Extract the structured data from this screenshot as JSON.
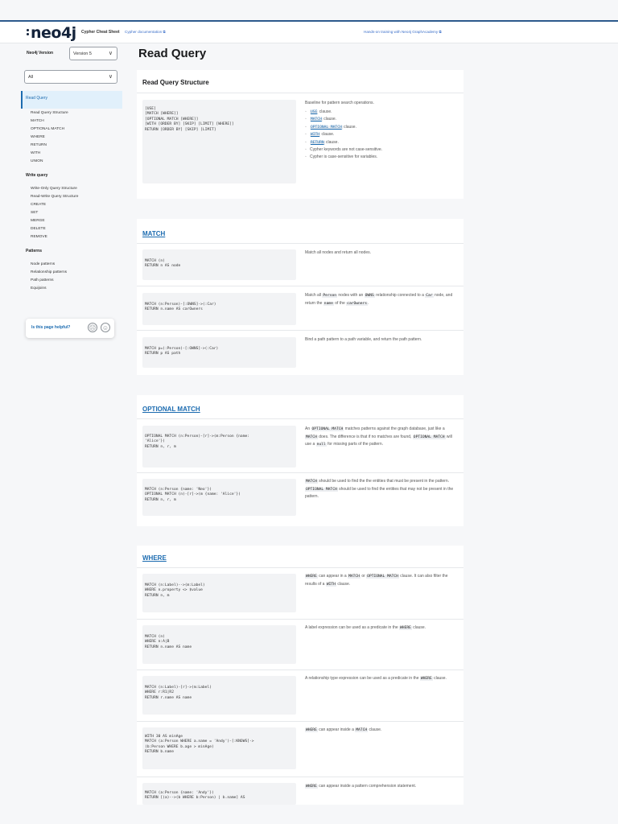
{
  "header": {
    "logo": "neo4j",
    "title": "Cypher Cheat Sheet",
    "docs_link": "Cypher documentation",
    "training_link": "Hands-on training with Neo4j GraphAcademy"
  },
  "sidebar": {
    "version_label": "Neo4j Version",
    "version_value": "Version 5",
    "filter_value": "All",
    "active_item": "Read Query",
    "read_items": [
      "Read Query Structure",
      "MATCH",
      "OPTIONAL MATCH",
      "WHERE",
      "RETURN",
      "WITH",
      "UNION"
    ],
    "write_section": "Write query",
    "write_items": [
      "Write-Only Query Structure",
      "Read-Write Query Structure",
      "CREATE",
      "SET",
      "MERGE",
      "DELETE",
      "REMOVE"
    ],
    "patterns_section": "Patterns",
    "pattern_items": [
      "Node patterns",
      "Relationship patterns",
      "Path patterns",
      "Equijoins"
    ],
    "helpful_text": "Is this page helpful?"
  },
  "main": {
    "page_title": "Read Query",
    "structure": {
      "title": "Read Query Structure",
      "code": "[USE]\n[MATCH [WHERE]]\n[OPTIONAL MATCH [WHERE]]\n[WITH [ORDER BY] [SKIP] [LIMIT] [WHERE]]\nRETURN [ORDER BY] [SKIP] [LIMIT]",
      "desc_intro": "Baseline for pattern search operations.",
      "bullets": [
        {
          "code": "USE",
          "text": " clause."
        },
        {
          "code": "MATCH",
          "text": " clause."
        },
        {
          "code": "OPTIONAL MATCH",
          "text": " clause."
        },
        {
          "code": "WITH",
          "text": " clause."
        },
        {
          "code": "RETURN",
          "text": " clause."
        },
        {
          "code": "",
          "text": "Cypher keywords are not case-sensitive."
        },
        {
          "code": "",
          "text": "Cypher is case-sensitive for variables."
        }
      ]
    },
    "match": {
      "title": "MATCH",
      "rows": [
        {
          "code": "MATCH (n)\nRETURN n AS node",
          "desc": "Match all nodes and return all nodes."
        },
        {
          "code": "MATCH (n:Person)-[:OWNS]->(:Car)\nRETURN n.name AS carOwners",
          "desc": "Match all Person nodes with an OWNS relationship connected to a Car node, and return the name of the carOwners."
        },
        {
          "code": "MATCH p=(:Person)-[:OWNS]->(:Car)\nRETURN p AS path",
          "desc": "Bind a path pattern to a path variable, and return the path pattern."
        }
      ]
    },
    "optional_match": {
      "title": "OPTIONAL MATCH",
      "rows": [
        {
          "code": "OPTIONAL MATCH (n:Person)-[r]->(m:Person {name:\n'Alice'})\nRETURN n, r, m",
          "desc": "An OPTIONAL MATCH matches patterns against the graph database, just like a MATCH does. The difference is that if no matches are found, OPTIONAL MATCH will use a null for missing parts of the pattern."
        },
        {
          "code": "MATCH (n:Person {name: 'Neo'})\nOPTIONAL MATCH (n)-[r]->(m {name: 'Alice'})\nRETURN n, r, m",
          "desc": "MATCH should be used to find the the entities that must be present in the pattern. OPTIONAL MATCH should be used to find the entities that may not be present in the pattern."
        }
      ]
    },
    "where": {
      "title": "WHERE",
      "rows": [
        {
          "code": "MATCH (n:Label)-->(m:Label)\nWHERE n.property <> $value\nRETURN n, m",
          "desc": "WHERE can appear in a MATCH or OPTIONAL MATCH clause. It can also filter the results of a WITH clause."
        },
        {
          "code": "MATCH (n)\nWHERE n:A|B\nRETURN n.name AS name",
          "desc": "A label expression can be used as a predicate in the WHERE clause."
        },
        {
          "code": "MATCH (n:Label)-[r]->(m:Label)\nWHERE r:R1|R2\nRETURN r.name AS name",
          "desc": "A relationship type expression can be used as a predicate in the WHERE clause."
        },
        {
          "code": "WITH 30 AS minAge\nMATCH (a:Person WHERE a.name = 'Andy')-[:KNOWS]->\n(b:Person WHERE b.age > minAge)\nRETURN b.name",
          "desc": "WHERE can appear inside a MATCH clause."
        },
        {
          "code": "MATCH (a:Person {name: 'Andy'})\nRETURN [(a)-->(b WHERE b:Person) | b.name] AS",
          "desc": "WHERE can appear inside a pattern comprehension statement."
        }
      ]
    }
  }
}
